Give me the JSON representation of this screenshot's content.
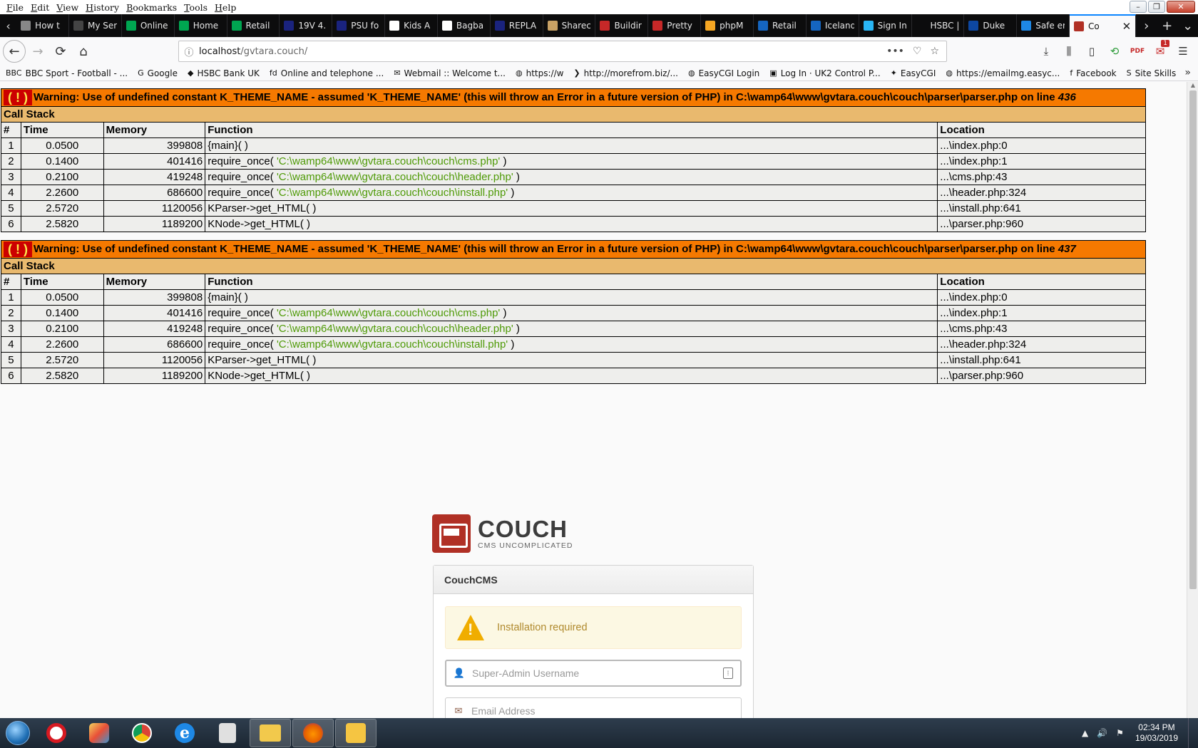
{
  "menu": [
    "File",
    "Edit",
    "View",
    "History",
    "Bookmarks",
    "Tools",
    "Help"
  ],
  "window_controls": {
    "minimize": "–",
    "restore": "❐",
    "close": "✕"
  },
  "tabs": [
    {
      "label": "How t",
      "color": "#888888"
    },
    {
      "label": "My Service",
      "color": "#444444"
    },
    {
      "label": "Online",
      "color": "#00a651"
    },
    {
      "label": "Home",
      "color": "#00a651"
    },
    {
      "label": "Retail",
      "color": "#00a651"
    },
    {
      "label": "19V 4.",
      "color": "#1a237e"
    },
    {
      "label": "PSU fo",
      "color": "#1a237e"
    },
    {
      "label": "Kids A",
      "color": "#ffffff"
    },
    {
      "label": "Bagba",
      "color": "#ffffff"
    },
    {
      "label": "REPLA",
      "color": "#1a237e"
    },
    {
      "label": "Sharec",
      "color": "#c8a165"
    },
    {
      "label": "Buildir",
      "color": "#c62828"
    },
    {
      "label": "Pretty",
      "color": "#c62828"
    },
    {
      "label": "phpM",
      "color": "#f5a623"
    },
    {
      "label": "Retail",
      "color": "#1565c0"
    },
    {
      "label": "Iceland",
      "color": "#1565c0"
    },
    {
      "label": "Sign In",
      "color": "#29b6f6"
    },
    {
      "label": "HSBC | Bu",
      "color": "#0c0c0d"
    },
    {
      "label": "Duke",
      "color": "#0d47a1"
    },
    {
      "label": "Safe er",
      "color": "#1e88e5"
    }
  ],
  "active_tab": {
    "label": "Co",
    "color": "#b03025",
    "close": "✕"
  },
  "nav": {
    "back_icon": "←",
    "forward_icon": "→",
    "reload_icon": "⟳",
    "home_icon": "⌂",
    "url_host": "localhost",
    "url_path": "/gvtara.couch/",
    "info_icon": "ⓘ",
    "more_icon": "•••",
    "pocket_icon": "♡",
    "star_icon": "☆"
  },
  "toolbar_icons": {
    "download": "⤓",
    "library": "⫼",
    "sidebar": "▯",
    "ext1": "⟲",
    "pdf": "PDF",
    "badge_ext": "✉",
    "badge_count": "1",
    "menu": "☰"
  },
  "bookmarks": [
    {
      "icon": "BBC",
      "label": "BBC Sport - Football - ..."
    },
    {
      "icon": "G",
      "label": "Google"
    },
    {
      "icon": "◆",
      "label": "HSBC Bank UK"
    },
    {
      "icon": "fd",
      "label": "Online and telephone ..."
    },
    {
      "icon": "✉",
      "label": "Webmail :: Welcome t..."
    },
    {
      "icon": "◍",
      "label": "https://w"
    },
    {
      "icon": "❯",
      "label": "http://morefrom.biz/..."
    },
    {
      "icon": "◍",
      "label": "EasyCGI Login"
    },
    {
      "icon": "▣",
      "label": "Log In · UK2 Control P..."
    },
    {
      "icon": "✦",
      "label": "EasyCGI"
    },
    {
      "icon": "◍",
      "label": "https://emailmg.easyc..."
    },
    {
      "icon": "f",
      "label": "Facebook"
    },
    {
      "icon": "S",
      "label": "Site Skills"
    }
  ],
  "bookmarks_more": "»",
  "warnings": [
    {
      "icon": "( ! )",
      "message": "Warning: Use of undefined constant K_THEME_NAME - assumed 'K_THEME_NAME' (this will throw an Error in a future version of PHP) in C:\\wamp64\\www\\gvtara.couch\\couch\\parser\\parser.php on line ",
      "line": "436",
      "call_stack_label": "Call Stack",
      "headers": [
        "#",
        "Time",
        "Memory",
        "Function",
        "Location"
      ],
      "rows": [
        {
          "n": "1",
          "time": "0.0500",
          "mem": "399808",
          "fn": "{main}( )",
          "arg": "",
          "fn_end": "",
          "loc": "...\\index.php:0"
        },
        {
          "n": "2",
          "time": "0.1400",
          "mem": "401416",
          "fn": "require_once( ",
          "arg": "'C:\\wamp64\\www\\gvtara.couch\\couch\\cms.php'",
          "fn_end": " )",
          "loc": "...\\index.php:1"
        },
        {
          "n": "3",
          "time": "0.2100",
          "mem": "419248",
          "fn": "require_once( ",
          "arg": "'C:\\wamp64\\www\\gvtara.couch\\couch\\header.php'",
          "fn_end": " )",
          "loc": "...\\cms.php:43"
        },
        {
          "n": "4",
          "time": "2.2600",
          "mem": "686600",
          "fn": "require_once( ",
          "arg": "'C:\\wamp64\\www\\gvtara.couch\\couch\\install.php'",
          "fn_end": " )",
          "loc": "...\\header.php:324"
        },
        {
          "n": "5",
          "time": "2.5720",
          "mem": "1120056",
          "fn": "KParser->get_HTML( )",
          "arg": "",
          "fn_end": "",
          "loc": "...\\install.php:641"
        },
        {
          "n": "6",
          "time": "2.5820",
          "mem": "1189200",
          "fn": "KNode->get_HTML( )",
          "arg": "",
          "fn_end": "",
          "loc": "...\\parser.php:960"
        }
      ]
    },
    {
      "icon": "( ! )",
      "message": "Warning: Use of undefined constant K_THEME_NAME - assumed 'K_THEME_NAME' (this will throw an Error in a future version of PHP) in C:\\wamp64\\www\\gvtara.couch\\couch\\parser\\parser.php on line ",
      "line": "437",
      "call_stack_label": "Call Stack",
      "headers": [
        "#",
        "Time",
        "Memory",
        "Function",
        "Location"
      ],
      "rows": [
        {
          "n": "1",
          "time": "0.0500",
          "mem": "399808",
          "fn": "{main}( )",
          "arg": "",
          "fn_end": "",
          "loc": "...\\index.php:0"
        },
        {
          "n": "2",
          "time": "0.1400",
          "mem": "401416",
          "fn": "require_once( ",
          "arg": "'C:\\wamp64\\www\\gvtara.couch\\couch\\cms.php'",
          "fn_end": " )",
          "loc": "...\\index.php:1"
        },
        {
          "n": "3",
          "time": "0.2100",
          "mem": "419248",
          "fn": "require_once( ",
          "arg": "'C:\\wamp64\\www\\gvtara.couch\\couch\\header.php'",
          "fn_end": " )",
          "loc": "...\\cms.php:43"
        },
        {
          "n": "4",
          "time": "2.2600",
          "mem": "686600",
          "fn": "require_once( ",
          "arg": "'C:\\wamp64\\www\\gvtara.couch\\couch\\install.php'",
          "fn_end": " )",
          "loc": "...\\header.php:324"
        },
        {
          "n": "5",
          "time": "2.5720",
          "mem": "1120056",
          "fn": "KParser->get_HTML( )",
          "arg": "",
          "fn_end": "",
          "loc": "...\\install.php:641"
        },
        {
          "n": "6",
          "time": "2.5820",
          "mem": "1189200",
          "fn": "KNode->get_HTML( )",
          "arg": "",
          "fn_end": "",
          "loc": "...\\parser.php:960"
        }
      ]
    }
  ],
  "couch": {
    "logo_main": "COUCH",
    "logo_sub": "CMS UNCOMPLICATED",
    "panel_title": "CouchCMS",
    "alert_text": "Installation required",
    "username_placeholder": "Super-Admin Username",
    "email_placeholder": "Email Address",
    "user_icon": "👤",
    "email_icon": "✉",
    "keypass_icon": "⁞"
  },
  "taskbar": {
    "apps": [
      "opera",
      "paint",
      "chrome",
      "ie",
      "media",
      "folder",
      "firefox",
      "mailapp"
    ],
    "ie_glyph": "e",
    "tray_up": "▲",
    "tray_volume": "🔊",
    "tray_flag": "⚑",
    "time": "02:34 PM",
    "date": "19/03/2019"
  }
}
